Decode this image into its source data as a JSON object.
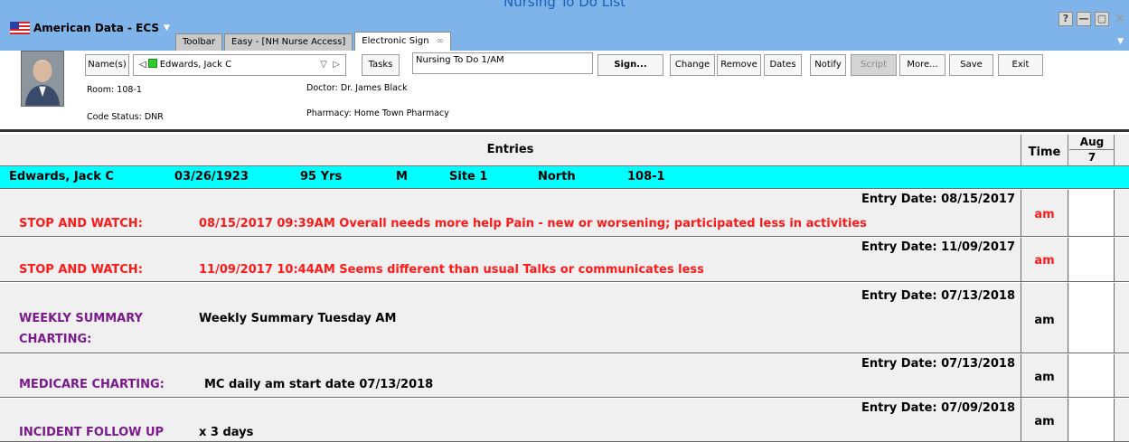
{
  "window": {
    "caption": "Nursing To Do List",
    "app_name": "American Data - ECS"
  },
  "tabs": [
    {
      "label": "Toolbar"
    },
    {
      "label": "Easy - [NH Nurse Access]"
    },
    {
      "label": "Electronic Sign"
    }
  ],
  "toolbar": {
    "names_label": "Name(s)",
    "patient_name": "Edwards, Jack C",
    "tasks_label": "Tasks",
    "task_value": "Nursing To Do 1/AM",
    "sign_label": "Sign...",
    "change_label": "Change",
    "remove_label": "Remove",
    "dates_label": "Dates",
    "notify_label": "Notify",
    "script_label": "Script",
    "more_label": "More...",
    "save_label": "Save",
    "exit_label": "Exit"
  },
  "patient_info": {
    "room": "Room: 108-1",
    "code_status": "Code Status: DNR",
    "doctor": "Doctor: Dr. James Black",
    "pharmacy": "Pharmacy: Home Town Pharmacy"
  },
  "grid": {
    "entries_header": "Entries",
    "time_header": "Time",
    "date_month": "Aug",
    "date_day": "7"
  },
  "patient_row": {
    "name": "Edwards, Jack C",
    "dob": "03/26/1923",
    "age": "95 Yrs",
    "sex": "M",
    "site": "Site 1",
    "wing": "North",
    "room": "108-1"
  },
  "entries": [
    {
      "entry_date": "Entry Date: 08/15/2017",
      "category": "STOP AND WATCH:",
      "text": "08/15/2017 09:39AM Overall needs more help Pain - new or worsening; participated less in activities",
      "time": "am"
    },
    {
      "entry_date": "Entry Date: 11/09/2017",
      "category": "STOP AND WATCH:",
      "text": "11/09/2017 10:44AM Seems different than usual Talks or communicates less",
      "time": "am"
    },
    {
      "entry_date": "Entry Date: 07/13/2018",
      "category_line1": "WEEKLY SUMMARY",
      "category_line2": "CHARTING:",
      "text": "Weekly Summary Tuesday AM",
      "time": "am"
    },
    {
      "entry_date": "Entry Date: 07/13/2018",
      "category": "MEDICARE CHARTING:",
      "text": "MC daily am start date  07/13/2018",
      "time": "am"
    },
    {
      "entry_date": "Entry Date: 07/09/2018",
      "category": "INCIDENT FOLLOW UP",
      "text": "x 3 days",
      "time": "am"
    }
  ],
  "colors": {
    "titlebar": "#7fb4ea",
    "patient_row": "#00ffff",
    "alert_red": "#ff1a1a",
    "category_purple": "#7a1a8c"
  }
}
